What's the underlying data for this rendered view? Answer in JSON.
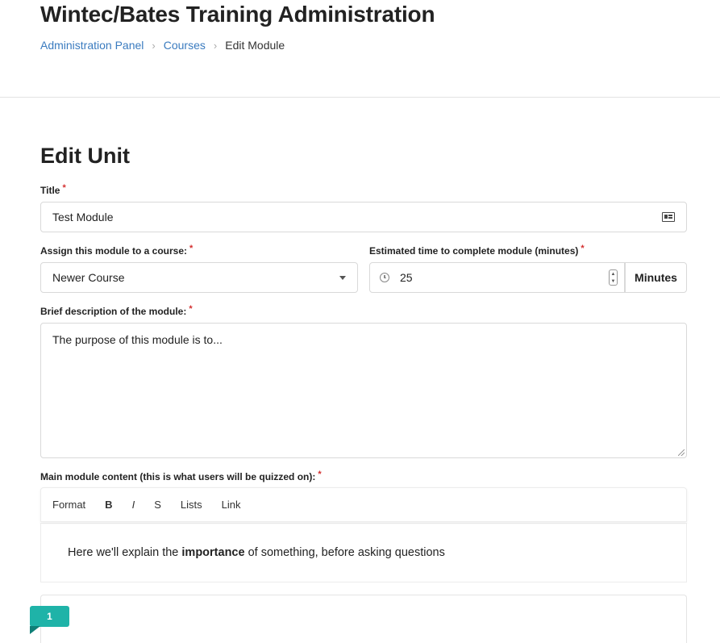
{
  "header": {
    "app_title": "Wintec/Bates Training Administration",
    "breadcrumb": [
      {
        "label": "Administration Panel"
      },
      {
        "label": "Courses"
      },
      {
        "label": "Edit Module"
      }
    ],
    "breadcrumb_separator": "›"
  },
  "form": {
    "heading": "Edit Unit",
    "required_marker": "*",
    "title": {
      "label": "Title",
      "value": "Test Module",
      "icon": "id-card-icon"
    },
    "course": {
      "label": "Assign this module to a course:",
      "value": "Newer Course",
      "icon": "chevron-down-icon"
    },
    "time": {
      "label": "Estimated time to complete module (minutes)",
      "value": "25",
      "icon": "clock-icon",
      "addon": "Minutes"
    },
    "description": {
      "label": "Brief description of the module:",
      "value": "The purpose of this module is to..."
    },
    "content": {
      "label": "Main module content (this is what users will be quizzed on):",
      "toolbar": {
        "format": "Format",
        "bold": "B",
        "italic": "I",
        "strike": "S",
        "lists": "Lists",
        "link": "Link"
      },
      "body": {
        "before": "Here we'll explain the ",
        "bold": "importance",
        "after": " of something, before asking questions"
      }
    }
  },
  "badge": {
    "count": "1",
    "color": "#1fb3a8"
  },
  "colors": {
    "link": "#3a7bbf",
    "required": "#d32f2f"
  }
}
